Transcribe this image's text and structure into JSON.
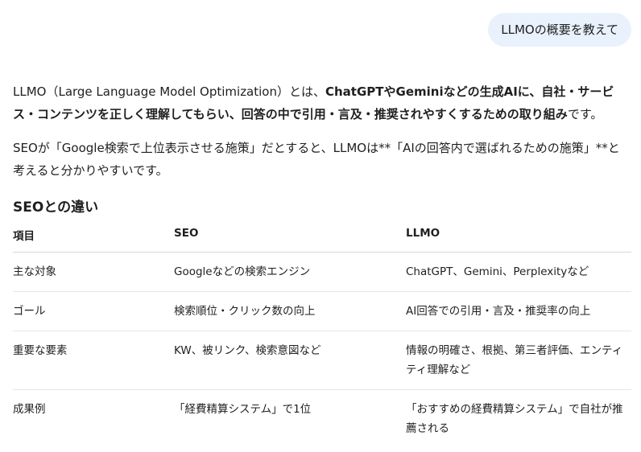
{
  "user_message": "LLMOの概要を教えて",
  "answer": {
    "p1": {
      "pre": "LLMO（Large Language Model Optimization）とは、",
      "bold": "ChatGPTやGeminiなどの生成AIに、自社・サービス・コンテンツを正しく理解してもらい、回答の中で引用・言及・推奨されやすくするための取り組み",
      "post": "です。"
    },
    "p2": "SEOが「Google検索で上位表示させる施策」だとすると、LLMOは**「AIの回答内で選ばれるための施策」**と考えると分かりやすいです。",
    "heading": "SEOとの違い",
    "table": {
      "headers": [
        "項目",
        "SEO",
        "LLMO"
      ],
      "rows": [
        [
          "主な対象",
          "Googleなどの検索エンジン",
          "ChatGPT、Gemini、Perplexityなど"
        ],
        [
          "ゴール",
          "検索順位・クリック数の向上",
          "AI回答での引用・言及・推奨率の向上"
        ],
        [
          "重要な要素",
          "KW、被リンク、検索意図など",
          "情報の明確さ、根拠、第三者評価、エンティティ理解など"
        ],
        [
          "成果例",
          "「経費精算システム」で1位",
          "「おすすめの経費精算システム」で自社が推薦される"
        ]
      ]
    }
  }
}
